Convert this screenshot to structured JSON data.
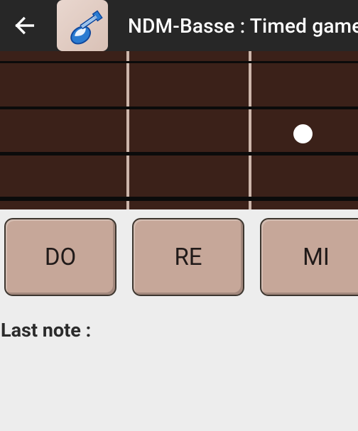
{
  "header": {
    "title": "NDM-Basse : Timed game",
    "back_icon": "back-arrow"
  },
  "fretboard": {
    "strings_count": 4,
    "frets_visible": 3,
    "note_dot": {
      "string_index": 2,
      "fret_index": 2
    }
  },
  "buttons": [
    {
      "label": "DO"
    },
    {
      "label": "RE"
    },
    {
      "label": "MI"
    }
  ],
  "status": {
    "last_note_label": "Last note :",
    "last_note_value": ""
  },
  "colors": {
    "header_bg": "#272727",
    "fret_wood": "#3b2119",
    "button_bg": "#c6a799",
    "page_bg": "#ededed"
  }
}
